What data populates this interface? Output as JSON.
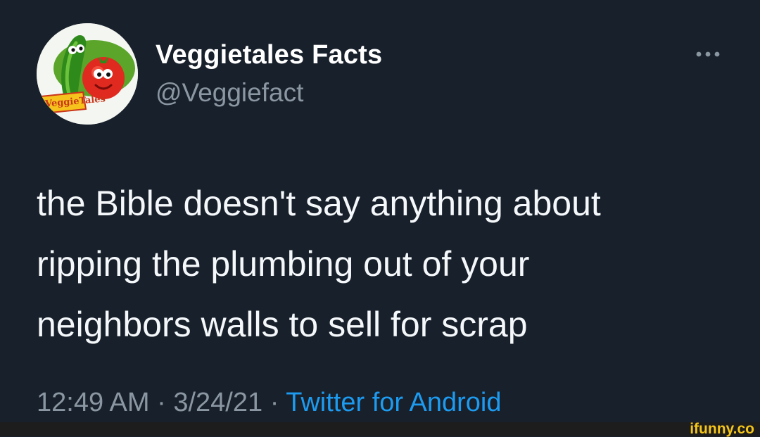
{
  "tweet": {
    "display_name": "Veggietales Facts",
    "handle": "@Veggiefact",
    "avatar_label": "VeggieTales",
    "text": "the Bible doesn't say anything about\nripping the plumbing out of your\nneighbors walls to sell for scrap",
    "time": "12:49 AM",
    "separator": " · ",
    "date": "3/24/21",
    "source": "Twitter for Android",
    "more_icon": "more-horizontal-icon"
  },
  "watermark": {
    "text": "ifunny.co"
  },
  "colors": {
    "background": "#18202b",
    "primary_text": "#f5f8fa",
    "secondary_text": "#8a97a3",
    "link": "#1d9bf0",
    "watermark": "#f5c518"
  }
}
